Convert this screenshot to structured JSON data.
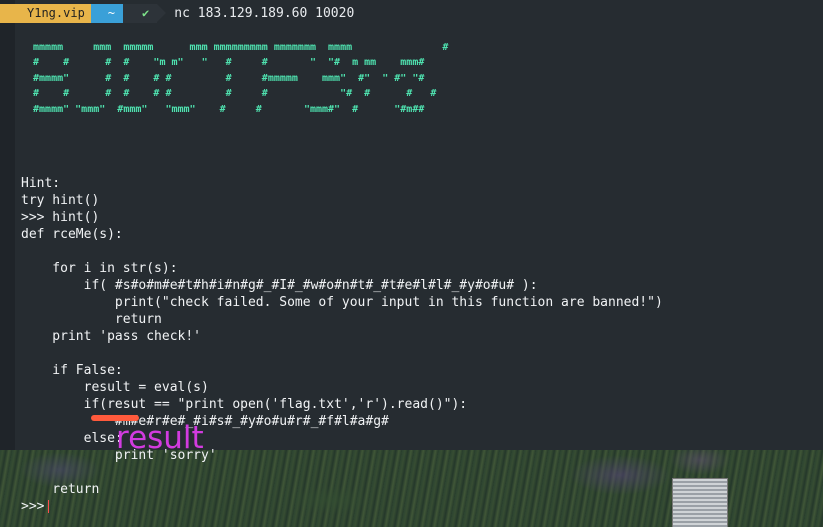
{
  "prompt": {
    "host": "Y1ng.vip",
    "dir": "~",
    "status": "✔",
    "command": "nc 183.129.189.60 10020"
  },
  "banner": [
    " mmmmm     mmm  mmmmm      mmm mmmmmmmmm mmmmmmm  mmmm               #",
    " #    #      #  #    \"m m\"   \"   #     #       \"  \"#  m mm    mmm#",
    " #mmmm\"      #  #    # #         #     #mmmmm    mmm\"  #\"  \" #\" \"#",
    " #    #      #  #    # #         #     #            \"#  #      #   #",
    " #mmmm\" \"mmm\"  #mmm\"   \"mmm\"    #     #       \"mmm#\"  #      \"#m##"
  ],
  "code_lines": [
    "Hint:",
    "try hint()",
    ">>> hint()",
    "def rceMe(s):",
    "",
    "    for i in str(s):",
    "        if( #s#o#m#e#t#h#i#n#g#_#I#_#w#o#n#t#_#t#e#l#l#_#y#o#u# ):",
    "            print(\"check failed. Some of your input in this function are banned!\")",
    "            return",
    "    print 'pass check!'",
    "",
    "    if False:",
    "        result = eval(s)",
    "        if(resut == \"print open('flag.txt','r').read()\"):",
    "            #m#e#r#e#_#i#s#_#y#o#u#r#_#f#l#a#g#",
    "        else:",
    "            print 'sorry'",
    "",
    "    return",
    ">>> "
  ],
  "annotation": "result",
  "colors": {
    "host_bg": "#e8b54a",
    "dir_bg": "#3aa0d8",
    "ok_fg": "#7ee38a",
    "banner": "#4fe3b0",
    "annotation": "#d23be0",
    "annotation_mark": "#ff5a3c"
  }
}
